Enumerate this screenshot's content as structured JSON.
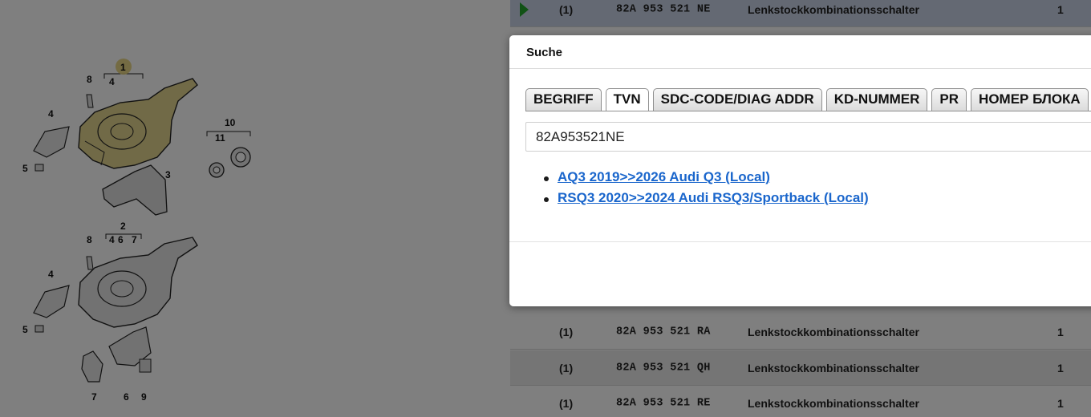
{
  "diagram": {
    "callouts": [
      "1",
      "4",
      "8",
      "4",
      "5",
      "3",
      "10",
      "11",
      "2",
      "8",
      "4",
      "6",
      "7",
      "4",
      "5",
      "7",
      "6",
      "9"
    ]
  },
  "parts_table": {
    "rows": [
      {
        "qty": "(1)",
        "part_number": "82A 953 521 NE",
        "description": "Lenkstockkombinationsschalter",
        "count": "1",
        "selected": true
      },
      {
        "qty": "(1)",
        "part_number": "82A 953 521 RA",
        "description": "Lenkstockkombinationsschalter",
        "count": "1",
        "selected": false
      },
      {
        "qty": "(1)",
        "part_number": "82A 953 521 QH",
        "description": "Lenkstockkombinationsschalter",
        "count": "1",
        "selected": false
      },
      {
        "qty": "(1)",
        "part_number": "82A 953 521 RE",
        "description": "Lenkstockkombinationsschalter",
        "count": "1",
        "selected": false
      }
    ],
    "colors": {
      "selected_row": "#c9d3e6",
      "play_icon": "#22a52a"
    }
  },
  "dialog": {
    "title": "Suche",
    "tabs": [
      {
        "label": "BEGRIFF",
        "active": false
      },
      {
        "label": "TVN",
        "active": true
      },
      {
        "label": "SDC-CODE/DIAG ADDR",
        "active": false
      },
      {
        "label": "KD-NUMMER",
        "active": false
      },
      {
        "label": "PR",
        "active": false
      },
      {
        "label": "НОМЕР БЛОКА",
        "active": false
      }
    ],
    "search_value": "82A953521NE",
    "results": [
      "AQ3 2019>>2026 Audi Q3 (Local)",
      "RSQ3 2020>>2024 Audi RSQ3/Sportback (Local)"
    ],
    "colors": {
      "link": "#1a66cc"
    }
  }
}
